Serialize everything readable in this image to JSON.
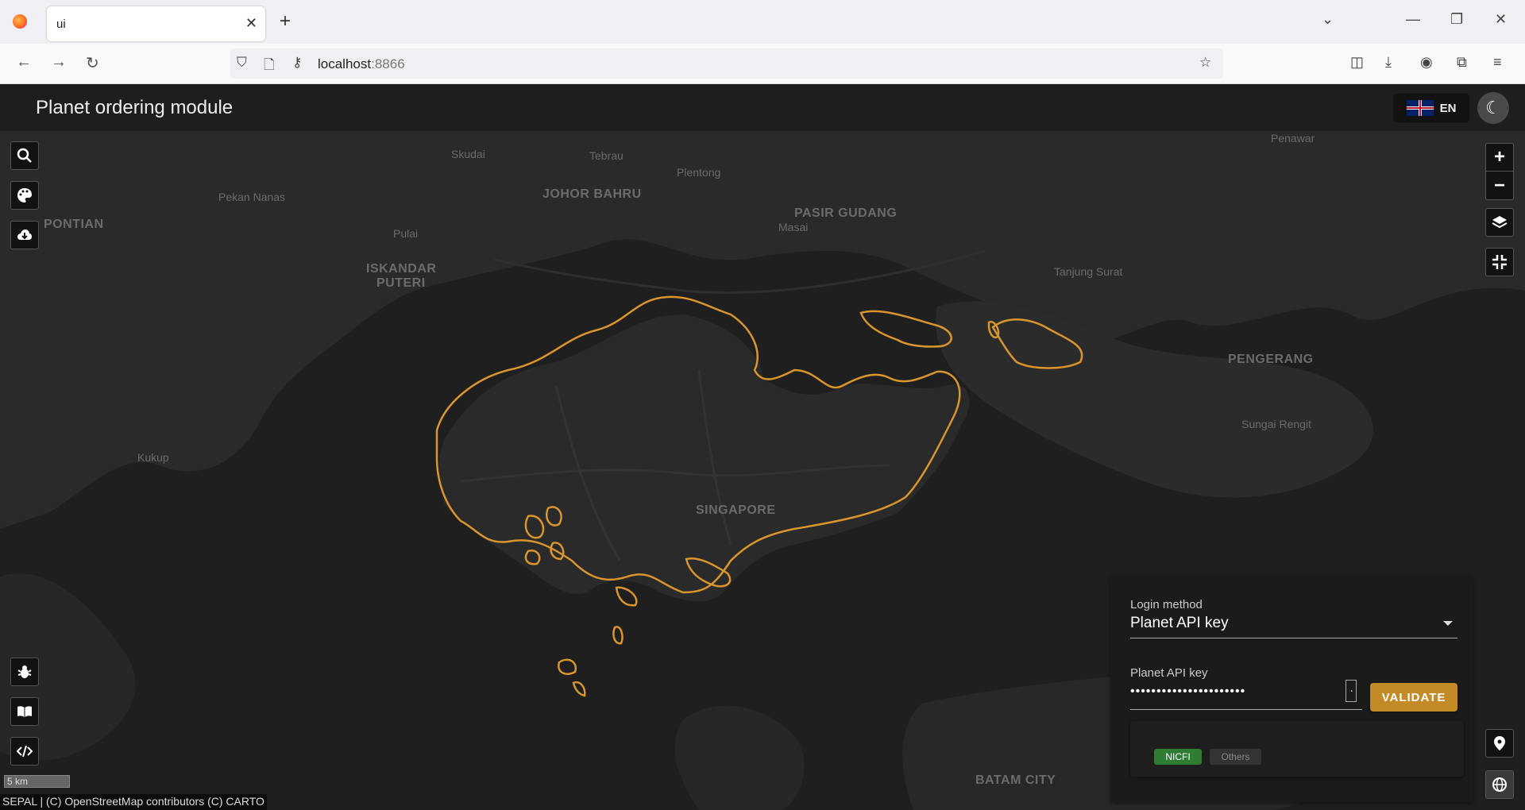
{
  "browser": {
    "tab_title": "ui",
    "url_host": "localhost",
    "url_port": ":8866"
  },
  "app": {
    "title": "Planet ordering module",
    "language": "EN"
  },
  "map": {
    "labels": {
      "skudai": "Skudai",
      "tebrau": "Tebrau",
      "plentong": "Plentong",
      "johor_bahru": "JOHOR BAHRU",
      "pasir_gudang": "PASIR GUDANG",
      "masai": "Masai",
      "pekan_nanas": "Pekan Nanas",
      "pontian": "PONTIAN",
      "pulai": "Pulai",
      "iskandar_puteri_1": "ISKANDAR",
      "iskandar_puteri_2": "PUTERI",
      "penawar": "Penawar",
      "tanjung_surat": "Tanjung Surat",
      "pengerang": "PENGERANG",
      "sungai_rengit": "Sungai Rengit",
      "kukup": "Kukup",
      "singapore": "SINGAPORE",
      "batam_city": "BATAM CITY"
    },
    "scale": "5 km",
    "attribution": "SEPAL | (C) OpenStreetMap contributors (C) CARTO"
  },
  "login": {
    "method_label": "Login method",
    "method_value": "Planet API key",
    "key_label": "Planet API key",
    "key_value": "••••••••••••••••••••••",
    "validate_label": "VALIDATE",
    "chips": {
      "nicfi": "NICFI",
      "others": "Others"
    }
  },
  "colors": {
    "accent": "#c48a25",
    "aoi_outline": "#d9962f",
    "chip_active": "#2e7d32"
  }
}
